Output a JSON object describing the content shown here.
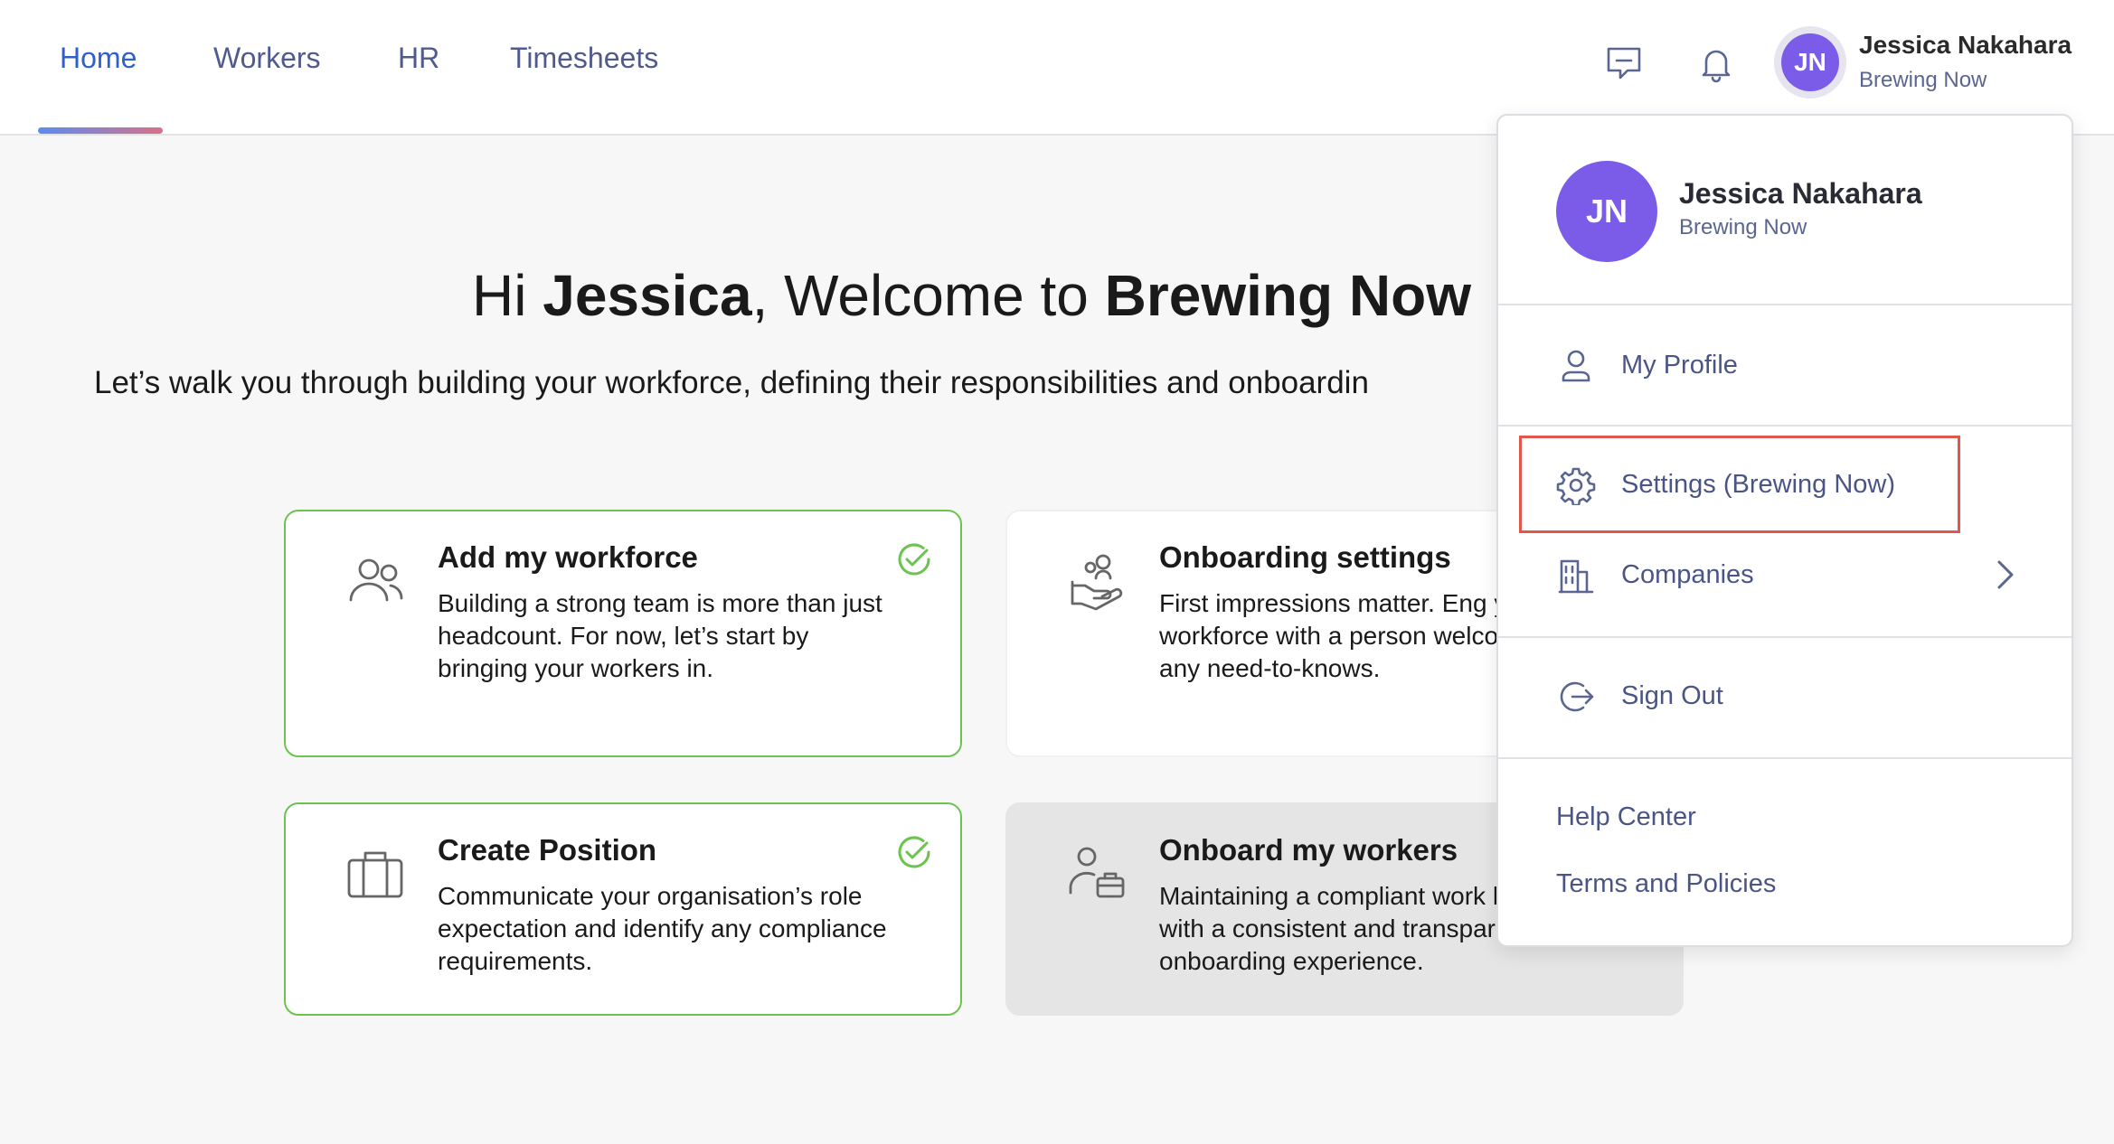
{
  "nav": {
    "tabs": [
      {
        "label": "Home",
        "active": true
      },
      {
        "label": "Workers"
      },
      {
        "label": "HR"
      },
      {
        "label": "Timesheets"
      }
    ],
    "icons": [
      "chat-icon",
      "bell-icon"
    ],
    "user": {
      "initials": "JN",
      "name": "Jessica Nakahara",
      "org": "Brewing Now"
    }
  },
  "welcome": {
    "greeting_prefix": "Hi ",
    "first_name": "Jessica",
    "greeting_middle": ", Welcome to ",
    "company": "Brewing Now",
    "subtitle": "Let’s walk you through building your workforce, defining their responsibilities and onboardin"
  },
  "cards": [
    {
      "title": "Add my workforce",
      "description": "Building a strong team is more than just headcount. For now, let’s start by bringing your workers in.",
      "completed": true,
      "icon": "people-icon"
    },
    {
      "title": "Onboarding settings",
      "description": "First impressions matter. Eng your workforce with a person welcome and any need-to-knows.",
      "completed": false,
      "icon": "hand-people-icon"
    },
    {
      "title": "Create Position",
      "description": "Communicate your organisation’s role expectation and identify any compliance requirements.",
      "completed": true,
      "icon": "briefcase-icon"
    },
    {
      "title": "Onboard my workers",
      "description": "Maintaining a compliant work begins with a consistent and transparent onboarding experience.",
      "completed": false,
      "icon": "person-briefcase-icon"
    }
  ],
  "dropdown": {
    "initials": "JN",
    "name": "Jessica Nakahara",
    "org": "Brewing Now",
    "items": [
      {
        "label": "My Profile",
        "icon": "user-icon"
      },
      {
        "label": "Settings (Brewing Now)",
        "icon": "gear-icon",
        "highlighted": true
      },
      {
        "label": "Companies",
        "icon": "building-icon",
        "has_submenu": true
      },
      {
        "label": "Sign Out",
        "icon": "sign-out-icon"
      }
    ],
    "links": [
      "Help Center",
      "Terms and Policies"
    ]
  },
  "colors": {
    "accent": "#2f5fd0",
    "avatar": "#7b5ce8",
    "completed": "#6cc34f",
    "highlight": "#e2574a",
    "menu_text": "#4b5585"
  }
}
